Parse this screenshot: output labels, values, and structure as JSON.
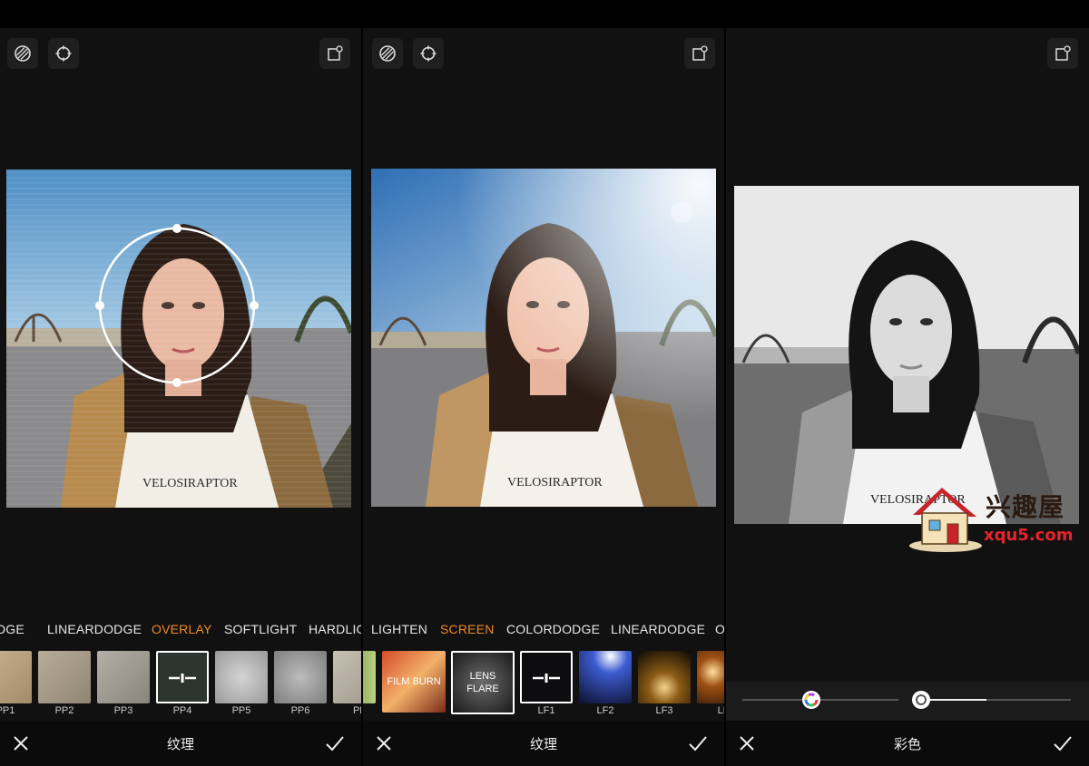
{
  "panels": [
    {
      "title": "纹理",
      "blend_modes": [
        "DGE",
        "LINEARDODGE",
        "OVERLAY",
        "SOFTLIGHT",
        "HARDLIG"
      ],
      "active_blend": "OVERLAY",
      "thumbs": [
        {
          "label": "PP1",
          "text": ""
        },
        {
          "label": "PP2",
          "text": ""
        },
        {
          "label": "PP3",
          "text": ""
        },
        {
          "label": "PP4",
          "text": ""
        },
        {
          "label": "PP5",
          "text": ""
        },
        {
          "label": "PP6",
          "text": ""
        },
        {
          "label": "PF",
          "text": ""
        }
      ]
    },
    {
      "title": "纹理",
      "blend_modes": [
        "LIGHTEN",
        "SCREEN",
        "COLORDODGE",
        "LINEARDODGE",
        "O"
      ],
      "active_blend": "SCREEN",
      "thumbs": [
        {
          "label": "",
          "text": ""
        },
        {
          "label": "",
          "text": "FILM BURN"
        },
        {
          "label": "",
          "text": "LENS FLARE"
        },
        {
          "label": "LF1",
          "text": ""
        },
        {
          "label": "LF2",
          "text": ""
        },
        {
          "label": "LF3",
          "text": ""
        },
        {
          "label": "LF",
          "text": ""
        }
      ]
    },
    {
      "title": "彩色",
      "slider": {
        "color_value": 0.44,
        "value": 0.41
      }
    }
  ],
  "photo_caption": "VELOSIRAPTOR",
  "watermark": {
    "cn": "兴趣屋",
    "url": "xqu5.com"
  },
  "colors": {
    "accent": "#f08a24",
    "panel_bg": "#111111",
    "bar_bg": "#0b0b0b"
  },
  "icons": [
    "texture-icon",
    "focus-icon",
    "export-icon",
    "close-icon",
    "check-icon",
    "color-wheel-icon"
  ]
}
